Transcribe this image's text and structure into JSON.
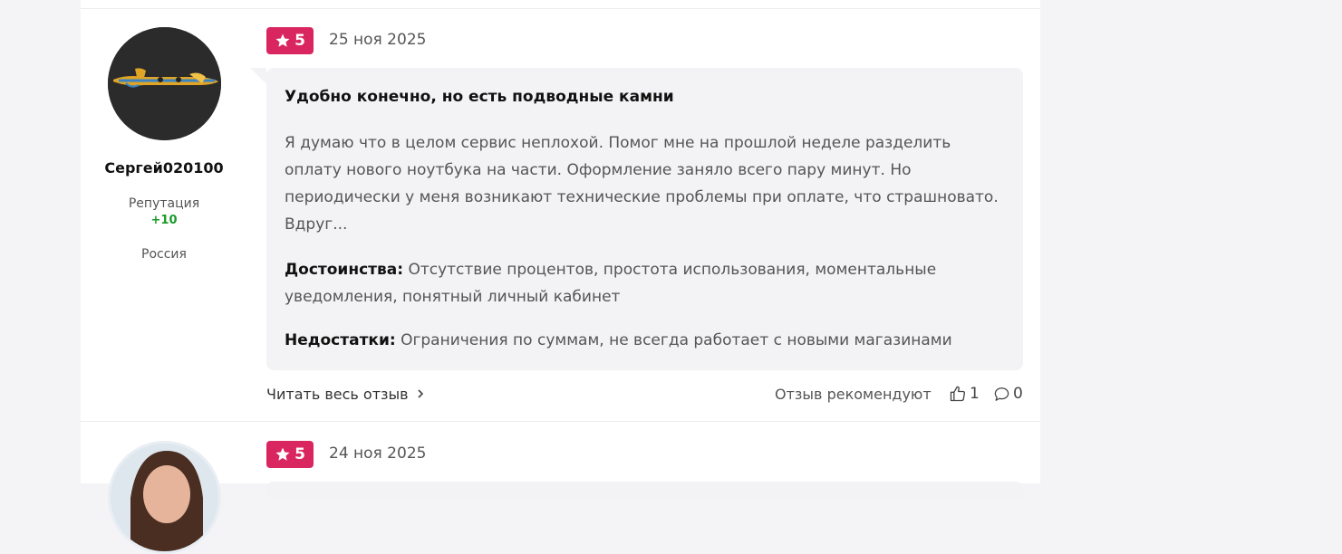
{
  "reviews": [
    {
      "author": {
        "name": "Сергей020100",
        "reputation_label": "Репутация",
        "reputation_value": "+10",
        "country": "Россия"
      },
      "rating": "5",
      "date": "25 ноя 2025",
      "title": "Удобно конечно, но есть подводные камни",
      "body": "Я думаю что в целом сервис неплохой. Помог мне на прошлой неделе разделить оплату нового ноутбука на части. Оформление заняло всего пару минут. Но периодически у меня возникают технические проблемы при оплате, что страшновато. Вдруг...",
      "pros_label": "Достоинства:",
      "pros": "Отсутствие процентов, простота использования, моментальные уведомления, понятный личный кабинет",
      "cons_label": "Недостатки:",
      "cons": "Ограничения по суммам, не всегда работает с новыми магазинами",
      "read_more": "Читать весь отзыв",
      "recommend_label": "Отзыв рекомендуют",
      "likes": "1",
      "comments": "0"
    },
    {
      "rating": "5",
      "date": "24 ноя 2025"
    }
  ],
  "icons": {
    "rating": "star-icon",
    "read_more": "chevron-right-icon",
    "likes": "thumbs-up-icon",
    "comments": "comment-icon"
  },
  "colors": {
    "rating_badge": "#d92660",
    "reputation_positive": "#1a9b2a",
    "bubble_background": "#f3f3f5"
  }
}
